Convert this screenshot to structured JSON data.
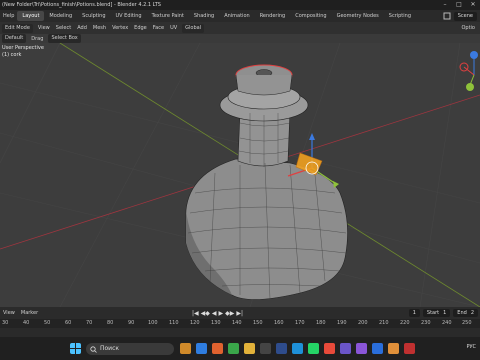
{
  "title_bar": {
    "title": "(New Folder\\Tri\\Potions_finish\\Potions.blend] - Blender 4.2.1 LTS",
    "controls": [
      "–",
      "□",
      "✕"
    ]
  },
  "topbar": {
    "menus": [
      "Help"
    ],
    "workspaces": [
      "Layout",
      "Modeling",
      "Sculpting",
      "UV Editing",
      "Texture Paint",
      "Shading",
      "Animation",
      "Rendering",
      "Compositing",
      "Geometry Nodes",
      "Scripting"
    ],
    "active_workspace": "Layout",
    "scene": "Scene"
  },
  "header": {
    "mode": "Edit Mode",
    "menus": [
      "View",
      "Select",
      "Add",
      "Mesh",
      "Vertex",
      "Edge",
      "Face",
      "UV"
    ],
    "transform_orientation": "Global",
    "options_label": "Optio"
  },
  "tool_settings": {
    "orientation": "Default",
    "drag_label": "Drag",
    "drag_value": "Select Box"
  },
  "viewport": {
    "view_name": "User Perspective",
    "object_name": "(1) cork"
  },
  "timeline": {
    "menus": [
      "View",
      "Marker"
    ],
    "play_controls": [
      "|◀",
      "◀◆",
      "◀",
      "▶",
      "◆▶",
      "▶|"
    ],
    "current_frame": "1",
    "start_label": "Start",
    "start_value": "1",
    "end_label": "End",
    "end_value": "2",
    "ruler_ticks": [
      "30",
      "40",
      "50",
      "60",
      "70",
      "80",
      "90",
      "100",
      "110",
      "120",
      "130",
      "140",
      "150",
      "160",
      "170",
      "180",
      "190",
      "200",
      "210",
      "220",
      "230",
      "240",
      "250"
    ]
  },
  "taskbar": {
    "search_placeholder": "Поиск",
    "tray_lang": "РУС"
  }
}
